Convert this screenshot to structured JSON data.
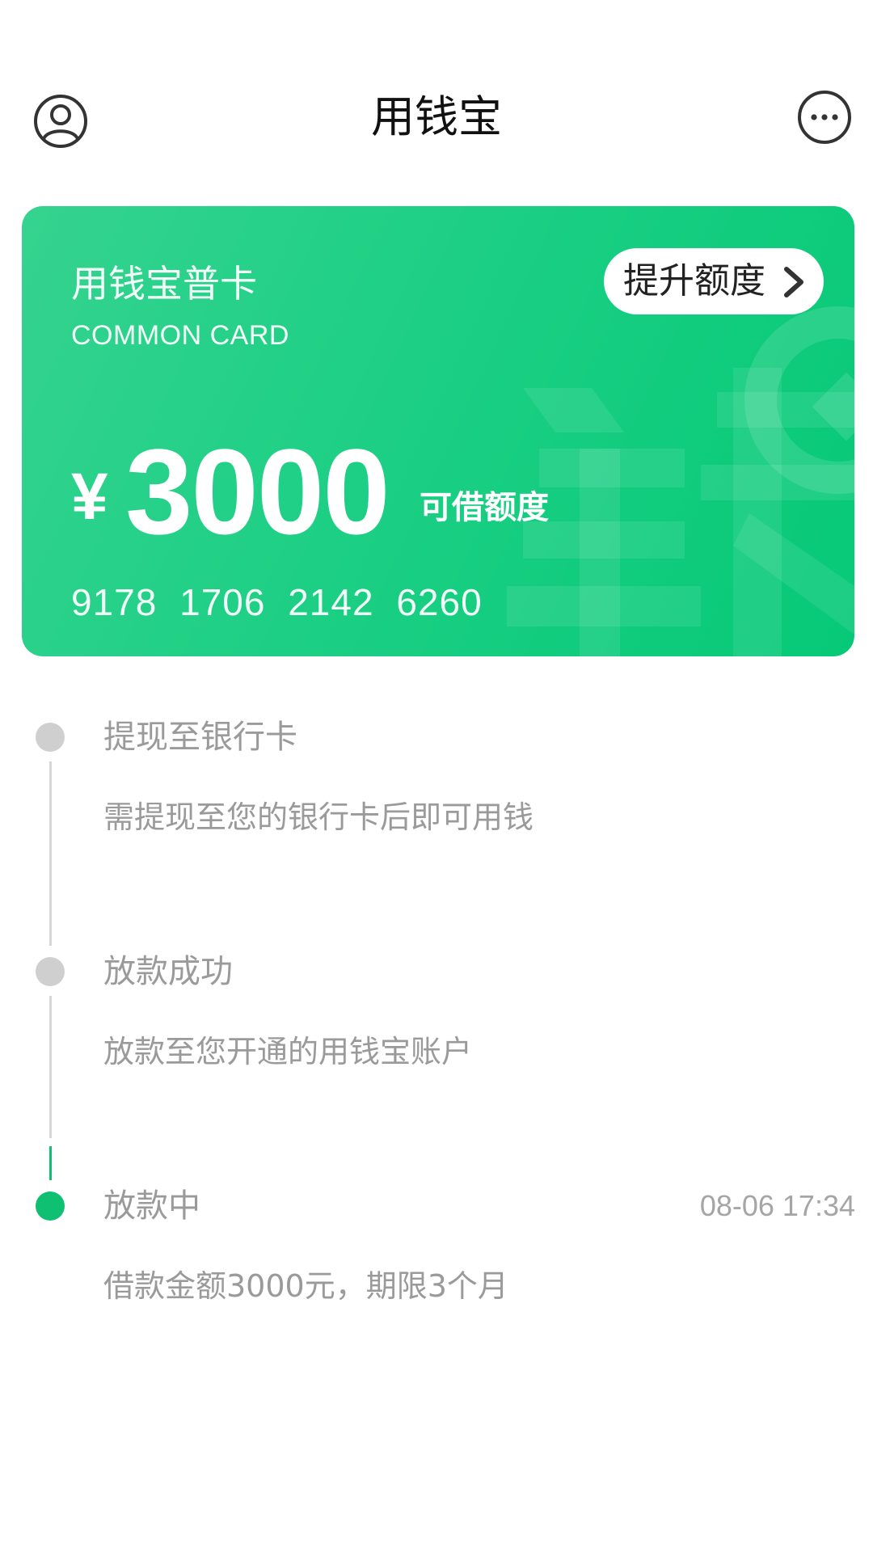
{
  "header": {
    "title": "用钱宝",
    "avatar_icon": "user-circle-icon",
    "more_icon": "more-ellipsis-icon"
  },
  "card": {
    "name": "用钱宝普卡",
    "subtitle": "COMMON CARD",
    "upgrade_label": "提升额度",
    "currency": "¥",
    "amount": "3000",
    "amount_label": "可借额度",
    "card_number": "9178 1706 2142 6260",
    "colors": {
      "gradient_start": "#35d38f",
      "gradient_end": "#06c977"
    }
  },
  "timeline": {
    "accent_color": "#0fbf72",
    "steps": [
      {
        "title": "提现至银行卡",
        "description": "需提现至您的银行卡后即可用钱",
        "time": "",
        "active": false
      },
      {
        "title": "放款成功",
        "description": "放款至您开通的用钱宝账户",
        "time": "",
        "active": false
      },
      {
        "title": "放款中",
        "description": "借款金额3000元，期限3个月",
        "time": "08-06 17:34",
        "active": true
      }
    ]
  }
}
